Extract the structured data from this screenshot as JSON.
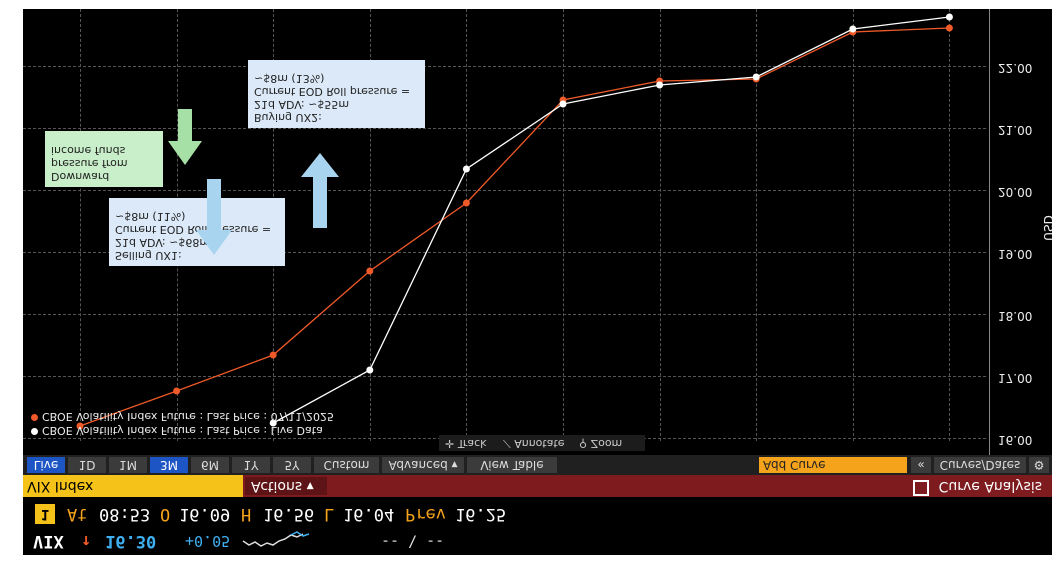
{
  "quote": {
    "row1": {
      "symbol": "VIX",
      "arrow": "↑",
      "price": "16.30",
      "change": "+0.05",
      "spark_icon": "sparkline",
      "dashes": "-- \\ --"
    },
    "row2": {
      "badge": "1",
      "at": "At",
      "time": "08:53",
      "open_label": "O",
      "open": "16.09",
      "high_label": "H",
      "high": "16.56",
      "low_label": "L",
      "low": "16.04",
      "prev_label": "Prev",
      "prev": "16.25"
    }
  },
  "menu": {
    "ticker": "VIX Index",
    "actions": "Actions ▾",
    "title": "Curve Analysis",
    "title_icon": "export-icon"
  },
  "toolbar": {
    "tabs": [
      "Live",
      "1D",
      "1M",
      "3M",
      "6M",
      "1Y",
      "5Y",
      "Custom",
      "Advanced ▾",
      "View Table"
    ],
    "selected": [
      "Live",
      "3M"
    ],
    "add_curve": "Add Curve",
    "collapse": "«",
    "curves_dates": "Curves/Dates",
    "settings_icon": "gear-icon"
  },
  "plot_tools": {
    "track": "Track",
    "annotate": "Annotate",
    "zoom": "Zoom"
  },
  "legend": [
    "CBOE Volatility Index Future : Last Price : 07/11/2025",
    "CBOE Volatility Index Future : Last Price : Live Data"
  ],
  "annotations": {
    "sell_note": [
      "Selling UX1:",
      "21d ADV: ~$68m",
      "Current EOD Roll pressure =",
      "~$8m (11%)"
    ],
    "buy_note": [
      "Buying UX2:",
      "21d ADV: ~$55m",
      "Current EOD Roll pressure =",
      "~$8m (13%)"
    ],
    "downward_note": [
      "Downward",
      "pressure from",
      "income funds"
    ]
  },
  "colors": {
    "series_0711": "#f05a28",
    "series_live": "#ffffff",
    "up_arrow": "#a8d4f0",
    "green_arrow": "#a6e0a6",
    "down_arrow": "#a8d4f0",
    "accent": "#f4c218",
    "menu": "#7e1b1f",
    "selected_tab": "#1e55c4"
  },
  "chart_data": {
    "type": "line",
    "ylabel": "USD",
    "y_ticks": [
      "16.00",
      "17.00",
      "18.00",
      "19.00",
      "20.00",
      "21.00",
      "22.00"
    ],
    "ylim": [
      15.6,
      22.95
    ],
    "y_axis": "inverted",
    "grid": true,
    "legend_position": "top-left",
    "series": [
      {
        "name": "CBOE Volatility Index Future : Last Price : 07/11/2025",
        "x_index": [
          1,
          2,
          3,
          4,
          5,
          6,
          7,
          8,
          9,
          10
        ],
        "values": [
          16.2,
          16.76,
          17.35,
          18.7,
          19.8,
          21.46,
          21.76,
          21.8,
          22.55,
          22.62
        ]
      },
      {
        "name": "CBOE Volatility Index Future : Last Price : Live Data",
        "x_index": [
          3,
          4,
          5,
          6,
          7,
          8,
          9,
          10
        ],
        "values": [
          16.25,
          17.1,
          20.35,
          21.39,
          21.7,
          21.83,
          22.61,
          22.8
        ]
      }
    ]
  }
}
